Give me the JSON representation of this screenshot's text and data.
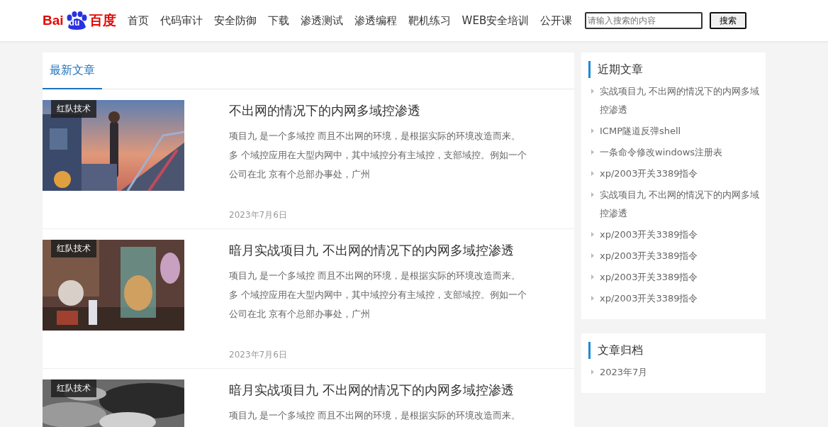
{
  "logo": {
    "left": "Bai",
    "paw": "du",
    "right": "百度"
  },
  "nav": [
    {
      "label": "首页"
    },
    {
      "label": "代码审计"
    },
    {
      "label": "安全防御"
    },
    {
      "label": "下载"
    },
    {
      "label": "渗透测试"
    },
    {
      "label": "渗透编程"
    },
    {
      "label": "靶机练习"
    },
    {
      "label": "WEB安全培训"
    },
    {
      "label": "公开课"
    }
  ],
  "search": {
    "placeholder": "请输入搜索的内容",
    "button": "搜索"
  },
  "tabs": [
    {
      "label": "最新文章",
      "selected": true
    }
  ],
  "articles": [
    {
      "category": "红队技术",
      "title": "不出网的情况下的内网多域控渗透",
      "excerpt": "项目九 是一个多域控 而且不出网的环境，是根据实际的环境改造而来。多 个域控应用在大型内网中，其中域控分有主域控，支部域控。例如一个公司在北 京有个总部办事处，广州",
      "date": "2023年7月6日"
    },
    {
      "category": "红队技术",
      "title": "暗月实战项目九 不出网的情况下的内网多域控渗透",
      "excerpt": "项目九 是一个多域控 而且不出网的环境，是根据实际的环境改造而来。多 个域控应用在大型内网中，其中域控分有主域控，支部域控。例如一个公司在北 京有个总部办事处，广州",
      "date": "2023年7月6日"
    },
    {
      "category": "红队技术",
      "title": "暗月实战项目九 不出网的情况下的内网多域控渗透",
      "excerpt": "项目九 是一个多域控 而且不出网的环境，是根据实际的环境改造而来。"
    }
  ],
  "recent_posts": {
    "title": "近期文章",
    "items": [
      "实战项目九 不出网的情况下的内网多域控渗透",
      "ICMP隧道反弹shell",
      "一条命令修改windows注册表",
      "xp/2003开关3389指令",
      "实战项目九 不出网的情况下的内网多域控渗透",
      "xp/2003开关3389指令",
      "xp/2003开关3389指令",
      "xp/2003开关3389指令",
      "xp/2003开关3389指令"
    ]
  },
  "archive": {
    "title": "文章归档",
    "items": [
      "2023年7月"
    ]
  }
}
